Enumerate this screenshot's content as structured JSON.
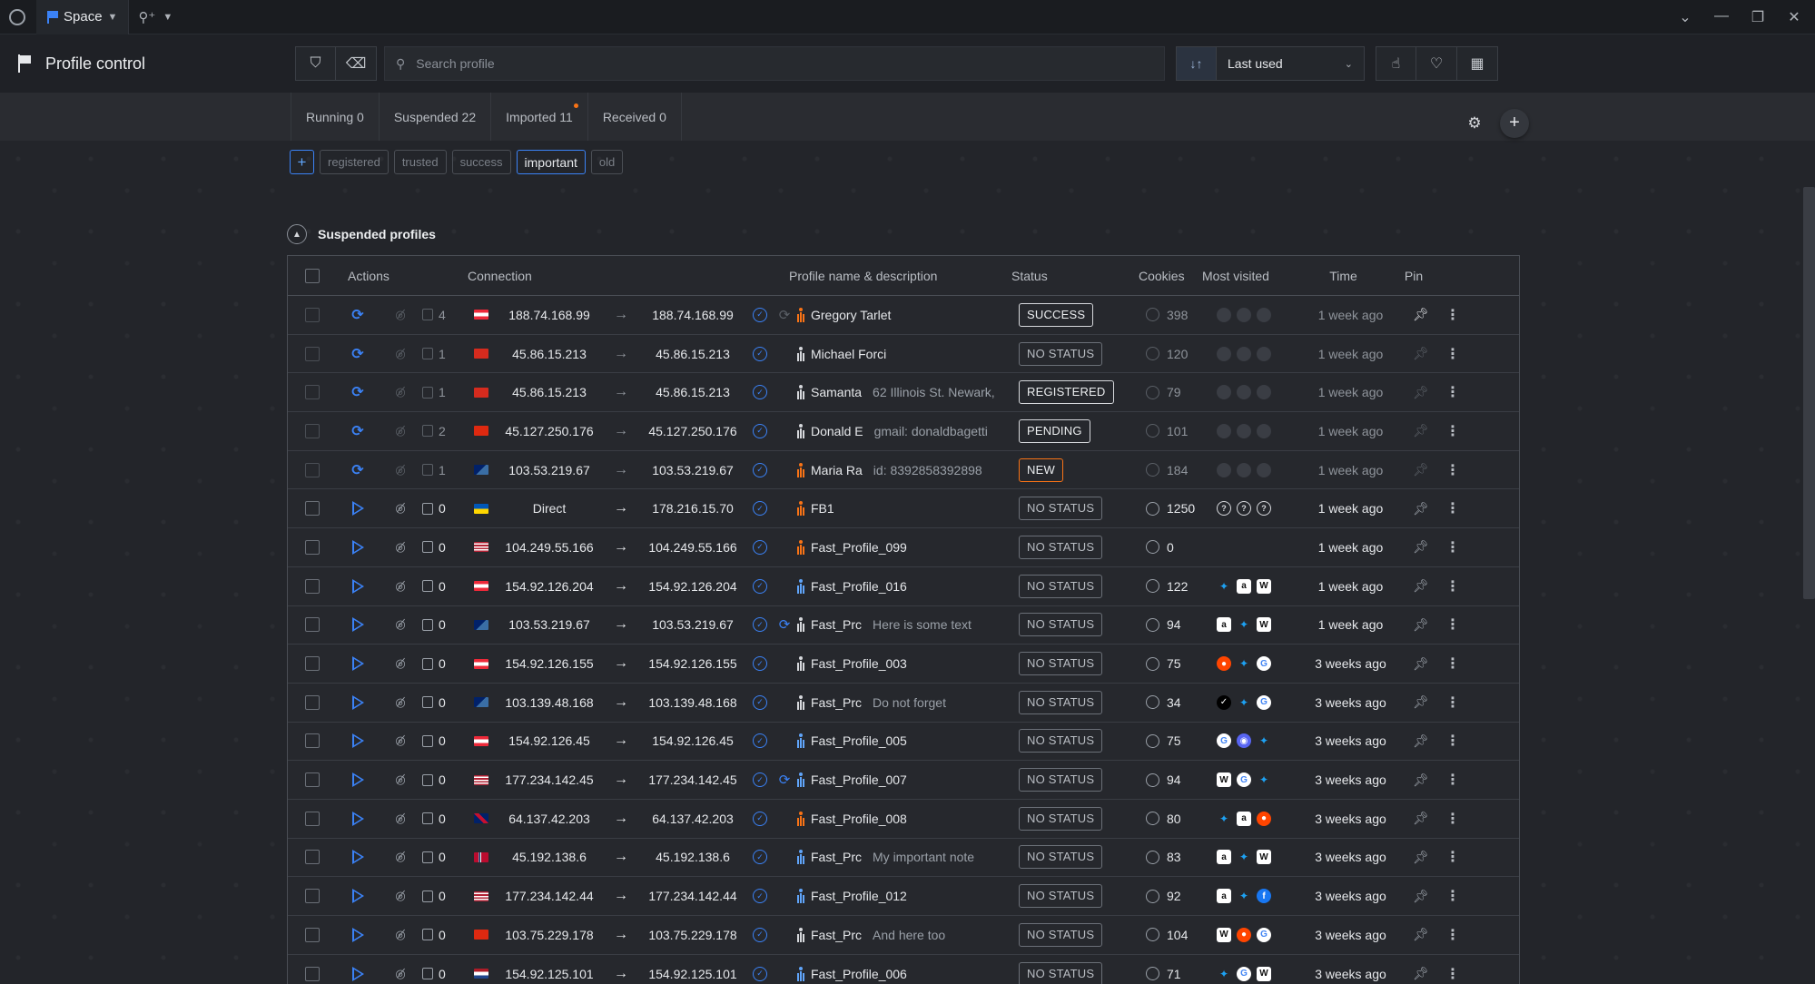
{
  "window": {
    "space_label": "Space",
    "controls": [
      "⌄",
      "—",
      "❐",
      "✕"
    ]
  },
  "header": {
    "title": "Profile control",
    "search_placeholder": "Search profile",
    "sort_value": "Last used"
  },
  "tabs": [
    {
      "label": "Running 0"
    },
    {
      "label": "Suspended 22"
    },
    {
      "label": "Imported 11"
    },
    {
      "label": "Received 0"
    }
  ],
  "tags": [
    "registered",
    "trusted",
    "success",
    "important",
    "old"
  ],
  "active_tag": "important",
  "section": {
    "title": "Suspended profiles"
  },
  "columns": {
    "actions": "Actions",
    "connection": "Connection",
    "profile": "Profile name & description",
    "status": "Status",
    "cookies": "Cookies",
    "visited": "Most visited",
    "time": "Time",
    "pin": "Pin"
  },
  "colors": {
    "accent": "#3b82f6",
    "new_badge": "#f97316"
  },
  "rows": [
    {
      "dim": true,
      "action": "sync",
      "copies": "4",
      "flag": "at",
      "from": "188.74.168.99",
      "to": "188.74.168.99",
      "sync2": true,
      "person_color": "#f97316",
      "name": "Gregory Tarlet",
      "desc": "",
      "status": "SUCCESS",
      "status_style": "strong",
      "cookies": "398",
      "sites": [
        "dim",
        "dim",
        "dim"
      ],
      "time": "1 week ago",
      "pinned": true
    },
    {
      "dim": true,
      "action": "sync",
      "copies": "1",
      "flag": "ch",
      "from": "45.86.15.213",
      "to": "45.86.15.213",
      "sync2": false,
      "person_color": "#d6d8dc",
      "name": "Michael Forci",
      "desc": "",
      "status": "NO STATUS",
      "status_style": "",
      "cookies": "120",
      "sites": [
        "dim",
        "dim",
        "dim"
      ],
      "time": "1 week ago",
      "pinned": false
    },
    {
      "dim": true,
      "action": "sync",
      "copies": "1",
      "flag": "ch",
      "from": "45.86.15.213",
      "to": "45.86.15.213",
      "sync2": false,
      "person_color": "#d6d8dc",
      "name": "Samanta",
      "desc": "62 Illinois St. Newark,",
      "status": "REGISTERED",
      "status_style": "strong",
      "cookies": "79",
      "sites": [
        "dim",
        "dim",
        "dim"
      ],
      "time": "1 week ago",
      "pinned": false
    },
    {
      "dim": true,
      "action": "sync",
      "copies": "2",
      "flag": "cn",
      "from": "45.127.250.176",
      "to": "45.127.250.176",
      "sync2": false,
      "person_color": "#d6d8dc",
      "name": "Donald E",
      "desc": "gmail: donaldbagetti",
      "status": "PENDING",
      "status_style": "strong",
      "cookies": "101",
      "sites": [
        "dim",
        "dim",
        "dim"
      ],
      "time": "1 week ago",
      "pinned": false
    },
    {
      "dim": true,
      "action": "sync",
      "copies": "1",
      "flag": "au",
      "from": "103.53.219.67",
      "to": "103.53.219.67",
      "sync2": false,
      "person_color": "#f97316",
      "name": "Maria Ra",
      "desc": "id: 8392858392898",
      "status": "NEW",
      "status_style": "new",
      "cookies": "184",
      "sites": [
        "dim",
        "dim",
        "dim"
      ],
      "time": "1 week ago",
      "pinned": false
    },
    {
      "dim": false,
      "action": "play",
      "copies": "0",
      "flag": "ua",
      "from": "Direct",
      "to": "178.216.15.70",
      "sync2": false,
      "person_color": "#f97316",
      "name": "FB1",
      "desc": "",
      "status": "NO STATUS",
      "status_style": "",
      "cookies": "1250",
      "sites": [
        "q",
        "q",
        "q"
      ],
      "time": "1 week ago",
      "pinned": false
    },
    {
      "dim": false,
      "action": "play",
      "copies": "0",
      "flag": "us",
      "from": "104.249.55.166",
      "to": "104.249.55.166",
      "sync2": false,
      "person_color": "#f97316",
      "name": "Fast_Profile_099",
      "desc": "",
      "status": "NO STATUS",
      "status_style": "",
      "cookies": "0",
      "sites": [],
      "time": "1 week ago",
      "pinned": false
    },
    {
      "dim": false,
      "action": "play",
      "copies": "0",
      "flag": "at",
      "from": "154.92.126.204",
      "to": "154.92.126.204",
      "sync2": false,
      "person_color": "#60a5fa",
      "name": "Fast_Profile_016",
      "desc": "",
      "status": "NO STATUS",
      "status_style": "",
      "cookies": "122",
      "sites": [
        "tw",
        "am",
        "wk"
      ],
      "time": "1 week ago",
      "pinned": false
    },
    {
      "dim": false,
      "action": "play",
      "copies": "0",
      "flag": "au",
      "from": "103.53.219.67",
      "to": "103.53.219.67",
      "sync2": true,
      "person_color": "#d6d8dc",
      "name": "Fast_Prc",
      "desc": "Here is some text",
      "status": "NO STATUS",
      "status_style": "",
      "cookies": "94",
      "sites": [
        "am",
        "tw",
        "wk"
      ],
      "time": "1 week ago",
      "pinned": false
    },
    {
      "dim": false,
      "action": "play",
      "copies": "0",
      "flag": "at",
      "from": "154.92.126.155",
      "to": "154.92.126.155",
      "sync2": false,
      "person_color": "#d6d8dc",
      "name": "Fast_Profile_003",
      "desc": "",
      "status": "NO STATUS",
      "status_style": "",
      "cookies": "75",
      "sites": [
        "rd",
        "tw",
        "gg"
      ],
      "time": "3 weeks ago",
      "pinned": false
    },
    {
      "dim": false,
      "action": "play",
      "copies": "0",
      "flag": "au",
      "from": "103.139.48.168",
      "to": "103.139.48.168",
      "sync2": false,
      "person_color": "#d6d8dc",
      "name": "Fast_Prc",
      "desc": "Do not forget",
      "status": "NO STATUS",
      "status_style": "",
      "cookies": "34",
      "sites": [
        "nk",
        "tw",
        "gg"
      ],
      "time": "3 weeks ago",
      "pinned": false
    },
    {
      "dim": false,
      "action": "play",
      "copies": "0",
      "flag": "at",
      "from": "154.92.126.45",
      "to": "154.92.126.45",
      "sync2": false,
      "person_color": "#60a5fa",
      "name": "Fast_Profile_005",
      "desc": "",
      "status": "NO STATUS",
      "status_style": "",
      "cookies": "75",
      "sites": [
        "gg",
        "dc",
        "tw"
      ],
      "time": "3 weeks ago",
      "pinned": false
    },
    {
      "dim": false,
      "action": "play",
      "copies": "0",
      "flag": "us",
      "from": "177.234.142.45",
      "to": "177.234.142.45",
      "sync2": true,
      "person_color": "#60a5fa",
      "name": "Fast_Profile_007",
      "desc": "",
      "status": "NO STATUS",
      "status_style": "",
      "cookies": "94",
      "sites": [
        "wk",
        "gg",
        "tw"
      ],
      "time": "3 weeks ago",
      "pinned": false
    },
    {
      "dim": false,
      "action": "play",
      "copies": "0",
      "flag": "gb",
      "from": "64.137.42.203",
      "to": "64.137.42.203",
      "sync2": false,
      "person_color": "#f97316",
      "name": "Fast_Profile_008",
      "desc": "",
      "status": "NO STATUS",
      "status_style": "",
      "cookies": "80",
      "sites": [
        "tw",
        "am",
        "rd"
      ],
      "time": "3 weeks ago",
      "pinned": false
    },
    {
      "dim": false,
      "action": "play",
      "copies": "0",
      "flag": "no",
      "from": "45.192.138.6",
      "to": "45.192.138.6",
      "sync2": false,
      "person_color": "#60a5fa",
      "name": "Fast_Prc",
      "desc": "My important note",
      "status": "NO STATUS",
      "status_style": "",
      "cookies": "83",
      "sites": [
        "am",
        "tw",
        "wk"
      ],
      "time": "3 weeks ago",
      "pinned": false
    },
    {
      "dim": false,
      "action": "play",
      "copies": "0",
      "flag": "us",
      "from": "177.234.142.44",
      "to": "177.234.142.44",
      "sync2": false,
      "person_color": "#60a5fa",
      "name": "Fast_Profile_012",
      "desc": "",
      "status": "NO STATUS",
      "status_style": "",
      "cookies": "92",
      "sites": [
        "am",
        "tw",
        "fb"
      ],
      "time": "3 weeks ago",
      "pinned": false
    },
    {
      "dim": false,
      "action": "play",
      "copies": "0",
      "flag": "hk",
      "from": "103.75.229.178",
      "to": "103.75.229.178",
      "sync2": false,
      "person_color": "#d6d8dc",
      "name": "Fast_Prc",
      "desc": "And here too",
      "status": "NO STATUS",
      "status_style": "",
      "cookies": "104",
      "sites": [
        "wk",
        "rd",
        "gg"
      ],
      "time": "3 weeks ago",
      "pinned": false
    },
    {
      "dim": false,
      "action": "play",
      "copies": "0",
      "flag": "nl",
      "from": "154.92.125.101",
      "to": "154.92.125.101",
      "sync2": false,
      "person_color": "#60a5fa",
      "name": "Fast_Profile_006",
      "desc": "",
      "status": "NO STATUS",
      "status_style": "",
      "cookies": "71",
      "sites": [
        "tw",
        "gg",
        "wk"
      ],
      "time": "3 weeks ago",
      "pinned": false
    }
  ]
}
